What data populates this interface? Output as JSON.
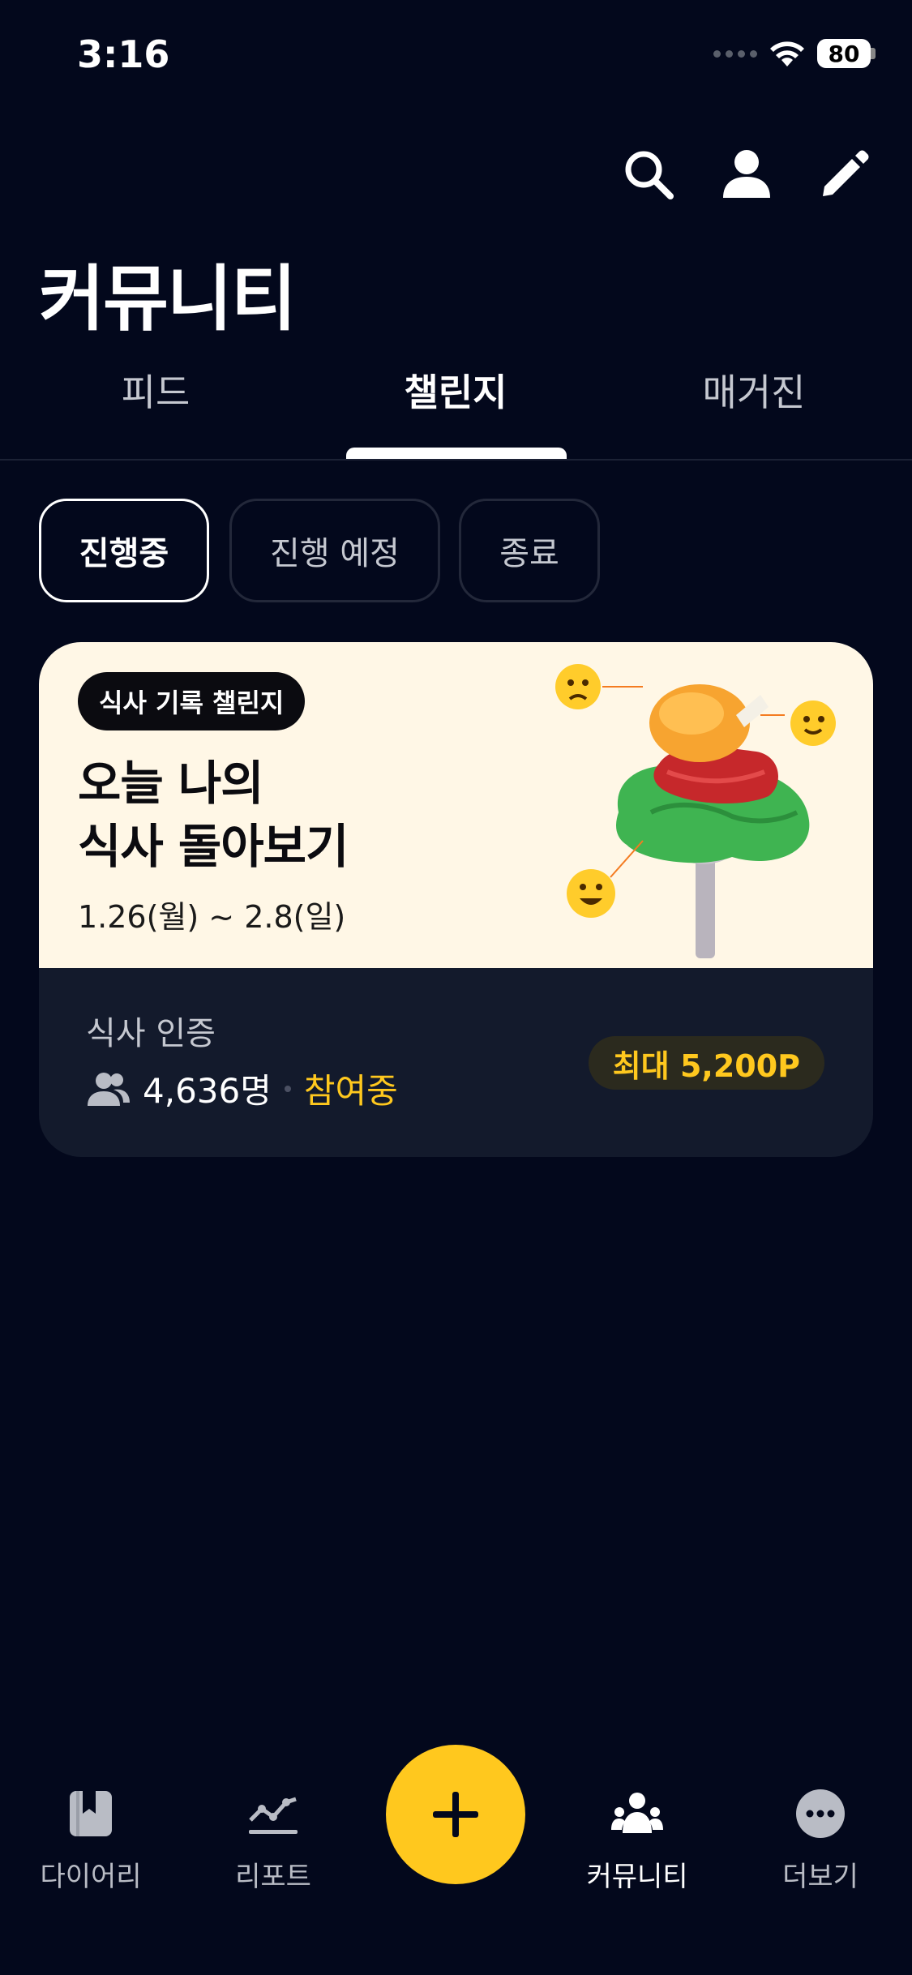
{
  "status_bar": {
    "time": "3:16",
    "battery": "80"
  },
  "header": {
    "title": "커뮤니티",
    "icons": [
      "search-icon",
      "profile-icon",
      "edit-icon"
    ]
  },
  "tabs": [
    {
      "label": "피드",
      "active": false
    },
    {
      "label": "챌린지",
      "active": true
    },
    {
      "label": "매거진",
      "active": false
    }
  ],
  "filters": [
    {
      "label": "진행중",
      "active": true
    },
    {
      "label": "진행 예정",
      "active": false
    },
    {
      "label": "종료",
      "active": false
    }
  ],
  "challenge_card": {
    "badge": "식사 기록 챌린지",
    "title_line1": "오늘 나의",
    "title_line2": "식사 돌아보기",
    "date_range": "1.26(월) ~ 2.8(일)",
    "subtitle": "식사 인증",
    "participants": "4,636명",
    "status": "참여중",
    "reward": "최대 5,200P"
  },
  "bottom_nav": {
    "items": [
      {
        "label": "다이어리",
        "icon": "diary-icon"
      },
      {
        "label": "리포트",
        "icon": "report-icon"
      },
      {
        "label": "커뮤니티",
        "icon": "community-icon",
        "active": true
      },
      {
        "label": "더보기",
        "icon": "more-icon"
      }
    ],
    "fab_icon": "plus-icon"
  },
  "colors": {
    "background": "#03081c",
    "accent_yellow": "#ffc81e",
    "card_banner": "#fff7e6",
    "card_body": "#131a2c"
  }
}
